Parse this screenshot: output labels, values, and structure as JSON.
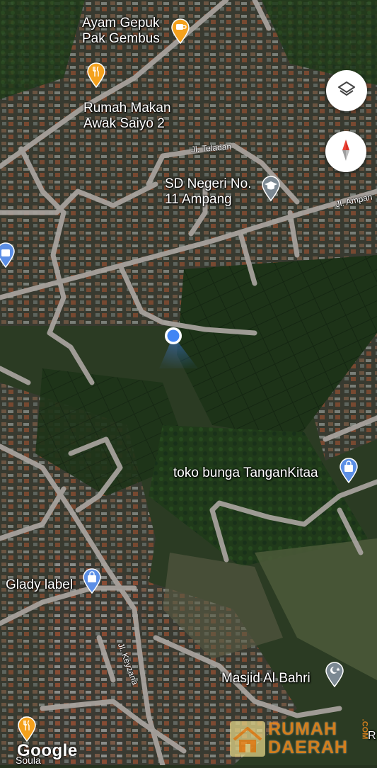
{
  "map": {
    "pois": [
      {
        "id": "ayam-gepuk",
        "label": "Ayam Gepuk\nPak Gembus",
        "category": "cafe",
        "color": "#f4a11d"
      },
      {
        "id": "rumah-makan",
        "label": "Rumah Makan\nAwak Saiyo 2",
        "category": "restaurant",
        "color": "#f4a11d"
      },
      {
        "id": "sd-negeri",
        "label": "SD Negeri No.\n11 Ampang",
        "category": "school",
        "color": "#7c8993"
      },
      {
        "id": "toko-bunga",
        "label": "toko bunga TanganKitaa",
        "category": "shopping",
        "color": "#5c8fe6"
      },
      {
        "id": "glady-label",
        "label": "Glady label",
        "category": "shopping",
        "color": "#5c8fe6"
      },
      {
        "id": "masjid",
        "label": "Masjid Al Bahri",
        "category": "mosque",
        "color": "#7c8993"
      }
    ],
    "roads": {
      "teladan": "Jl. Teladan",
      "ampang": "Jl. Ampan",
      "keyzana": "Jl. Keyzana"
    },
    "partial_labels": {
      "bottom_left": "Soula",
      "bottom_right": "R"
    }
  },
  "controls": {
    "layers_icon": "layers-icon",
    "compass_icon": "compass-icon"
  },
  "attribution": {
    "logo": "Google"
  },
  "watermark": {
    "line1": "RUMAH",
    "line2": "DAERAH",
    "suffix": ".COM"
  },
  "colors": {
    "location_dot": "#4285f4",
    "road": "#a9a49f",
    "food_pin": "#f4a11d",
    "shop_pin": "#5c8fe6",
    "gray_pin": "#7c8993"
  }
}
